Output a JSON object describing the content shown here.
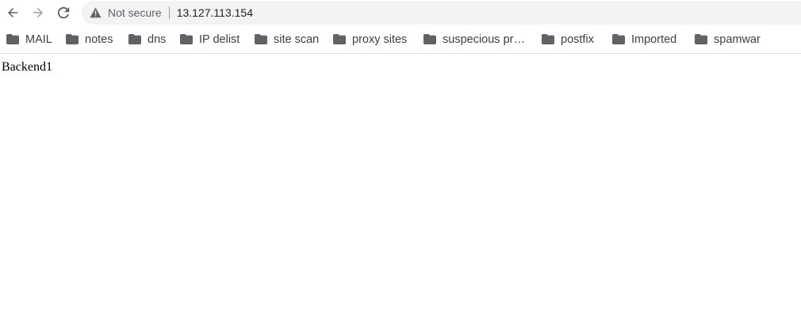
{
  "toolbar": {
    "back_icon": "arrow-left-icon",
    "forward_icon": "arrow-right-icon",
    "reload_icon": "reload-icon",
    "security_icon": "warning-triangle-icon",
    "security_text": "Not secure",
    "url": "13.127.113.154"
  },
  "bookmarks": [
    {
      "label": "MAIL",
      "icon": "folder-icon"
    },
    {
      "label": "notes",
      "icon": "folder-icon"
    },
    {
      "label": "dns",
      "icon": "folder-icon"
    },
    {
      "label": "IP delist",
      "icon": "folder-icon"
    },
    {
      "label": "site scan",
      "icon": "folder-icon"
    },
    {
      "label": "proxy sites",
      "icon": "folder-icon"
    },
    {
      "label": "suspecious pr…",
      "icon": "folder-icon"
    },
    {
      "label": "postfix",
      "icon": "folder-icon"
    },
    {
      "label": "Imported",
      "icon": "folder-icon"
    },
    {
      "label": "spamwar",
      "icon": "folder-icon"
    }
  ],
  "page": {
    "body_text": "Backend1"
  },
  "colors": {
    "omnibox_bg": "#f1f3f4",
    "icon_gray": "#5f6368",
    "icon_disabled": "#9aa0a6",
    "text": "#202124",
    "folder": "#5f6368"
  }
}
